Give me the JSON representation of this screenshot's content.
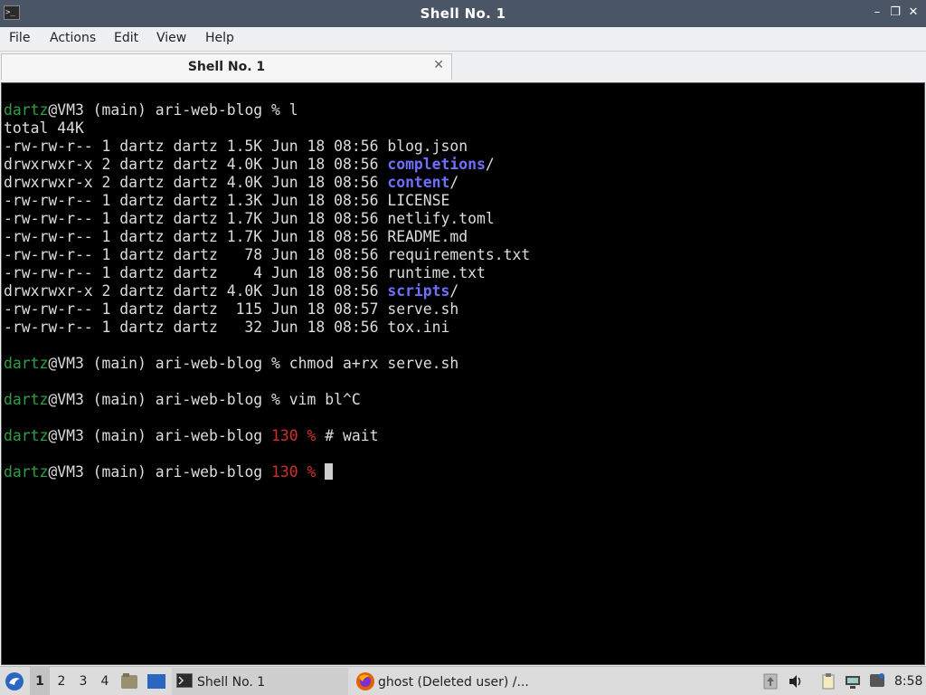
{
  "window": {
    "title": "Shell No. 1",
    "controls": {
      "minimize": "–",
      "restore": "❐",
      "close": "✕"
    }
  },
  "menu": [
    "File",
    "Actions",
    "Edit",
    "View",
    "Help"
  ],
  "tab": {
    "label": "Shell No. 1",
    "close": "✕"
  },
  "terminal": {
    "user": "dartz",
    "rest_prompt": "@VM3 (main) ari-web-blog ",
    "prompt_symbol": "%",
    "exit_code": "130",
    "cmd1": "l",
    "total": "total 44K",
    "entries": [
      {
        "meta": "-rw-rw-r-- 1 dartz dartz 1.5K Jun 18 08:56 ",
        "name": "blog.json",
        "dir": false
      },
      {
        "meta": "drwxrwxr-x 2 dartz dartz 4.0K Jun 18 08:56 ",
        "name": "completions",
        "dir": true
      },
      {
        "meta": "drwxrwxr-x 2 dartz dartz 4.0K Jun 18 08:56 ",
        "name": "content",
        "dir": true
      },
      {
        "meta": "-rw-rw-r-- 1 dartz dartz 1.3K Jun 18 08:56 ",
        "name": "LICENSE",
        "dir": false
      },
      {
        "meta": "-rw-rw-r-- 1 dartz dartz 1.7K Jun 18 08:56 ",
        "name": "netlify.toml",
        "dir": false
      },
      {
        "meta": "-rw-rw-r-- 1 dartz dartz 1.7K Jun 18 08:56 ",
        "name": "README.md",
        "dir": false
      },
      {
        "meta": "-rw-rw-r-- 1 dartz dartz   78 Jun 18 08:56 ",
        "name": "requirements.txt",
        "dir": false
      },
      {
        "meta": "-rw-rw-r-- 1 dartz dartz    4 Jun 18 08:56 ",
        "name": "runtime.txt",
        "dir": false
      },
      {
        "meta": "drwxrwxr-x 2 dartz dartz 4.0K Jun 18 08:56 ",
        "name": "scripts",
        "dir": true
      },
      {
        "meta": "-rw-rw-r-- 1 dartz dartz  115 Jun 18 08:57 ",
        "name": "serve.sh",
        "dir": false
      },
      {
        "meta": "-rw-rw-r-- 1 dartz dartz   32 Jun 18 08:56 ",
        "name": "tox.ini",
        "dir": false
      }
    ],
    "cmd2": "chmod a+rx serve.sh",
    "cmd3": "vim bl^C",
    "cmd4": "# wait"
  },
  "taskbar": {
    "workspaces": [
      "1",
      "2",
      "3",
      "4"
    ],
    "active_workspace": "1",
    "tasks": [
      {
        "label": "Shell No. 1",
        "active": true,
        "icon": "terminal-icon"
      },
      {
        "label": "ghost (Deleted user) /...",
        "active": false,
        "icon": "firefox-icon"
      }
    ],
    "clock": "8:58"
  },
  "colors": {
    "titlebar": "#4a5566",
    "terminal_bg": "#000000",
    "prompt_user": "#2ea043",
    "exit_code": "#d0312d",
    "directory": "#6f6fff",
    "task_active_underline": "#2b66c2"
  }
}
